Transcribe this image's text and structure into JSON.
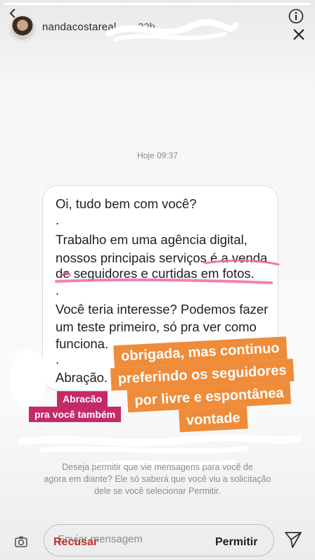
{
  "progress": {
    "fraction": 1.0
  },
  "header": {
    "username": "nandacostareal",
    "time": "22h"
  },
  "message": {
    "timestamp": "Hoje 09:37",
    "lines": [
      "Oi, tudo bem com você?",
      ".",
      "Trabalho em uma agência digital,",
      "nossos principais serviços é a venda",
      "de seguidores e curtidas em fotos.",
      ".",
      "Você teria interesse? Podemos fazer",
      "um teste primeiro, só pra ver como",
      "funciona.",
      ".",
      "Abração."
    ]
  },
  "stickers": {
    "pink": [
      "Abracão",
      "pra você também"
    ],
    "orange": [
      "obrigada, mas continuo",
      "preferindo os seguidores",
      "por livre e espontânea",
      "vontade"
    ]
  },
  "prompt": {
    "lines": [
      "Deseja permitir que           vie mensagens para você de",
      "agora em diante? Ele só saberá que você viu a solicitação",
      "dele se você selecionar Permitir."
    ]
  },
  "bottom": {
    "reply_placeholder": "Enviar mensagem",
    "refuse_label": "Recusar",
    "allow_label": "Permitir"
  },
  "colors": {
    "pink_tag": "#c42a68",
    "orange_tag": "#ee8c3a",
    "refuse": "#c0312a",
    "highlight": "#f06aa8"
  }
}
